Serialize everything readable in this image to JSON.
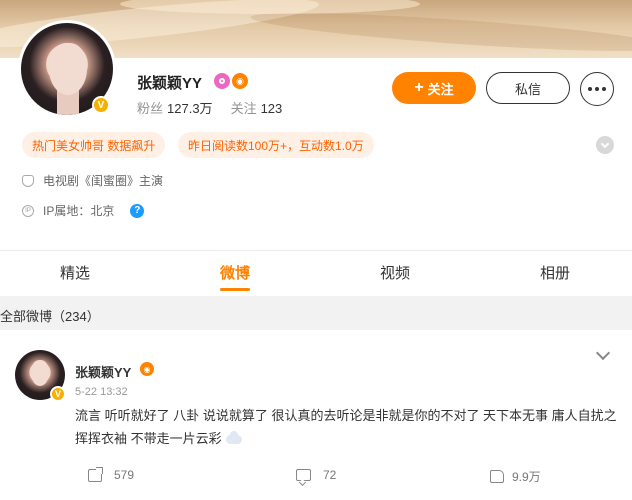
{
  "profile": {
    "name": "张颖颖YY",
    "verified_badge": "V",
    "fans_label": "粉丝",
    "fans_count": "127.3万",
    "following_label": "关注",
    "following_count": "123",
    "icons": [
      "v-verified-icon",
      "search-badge-icon",
      "fire-badge-icon"
    ]
  },
  "actions": {
    "follow_label": "关注",
    "message_label": "私信",
    "more_icon": "more-dots-icon"
  },
  "tags": [
    "热门美女帅哥 数据飙升",
    "昨日阅读数100万+，互动数1.0万"
  ],
  "info": {
    "drama": "电视剧《闺蜜圈》主演",
    "ip_location": "IP属地：北京"
  },
  "tabs": [
    {
      "label": "精选",
      "active": false
    },
    {
      "label": "微博",
      "active": true
    },
    {
      "label": "视频",
      "active": false
    },
    {
      "label": "相册",
      "active": false
    }
  ],
  "section": {
    "title": "全部微博（234）"
  },
  "post": {
    "author": "张颖颖YY",
    "time": "5-22 13:32",
    "text": "流言 听听就好了 八卦 说说就算了 很认真的去听论是非就是你的不对了 天下本无事 庸人自扰之 挥挥衣袖 不带走一片云彩",
    "emoji": "cloud-emoji",
    "repost_count": "579",
    "comment_count": "72",
    "like_count": "9.9万"
  },
  "colors": {
    "accent": "#ff8200",
    "tag_bg": "#fff0e5",
    "tag_text": "#ff6200",
    "verified": "#f6b100",
    "help": "#1e9bff"
  }
}
